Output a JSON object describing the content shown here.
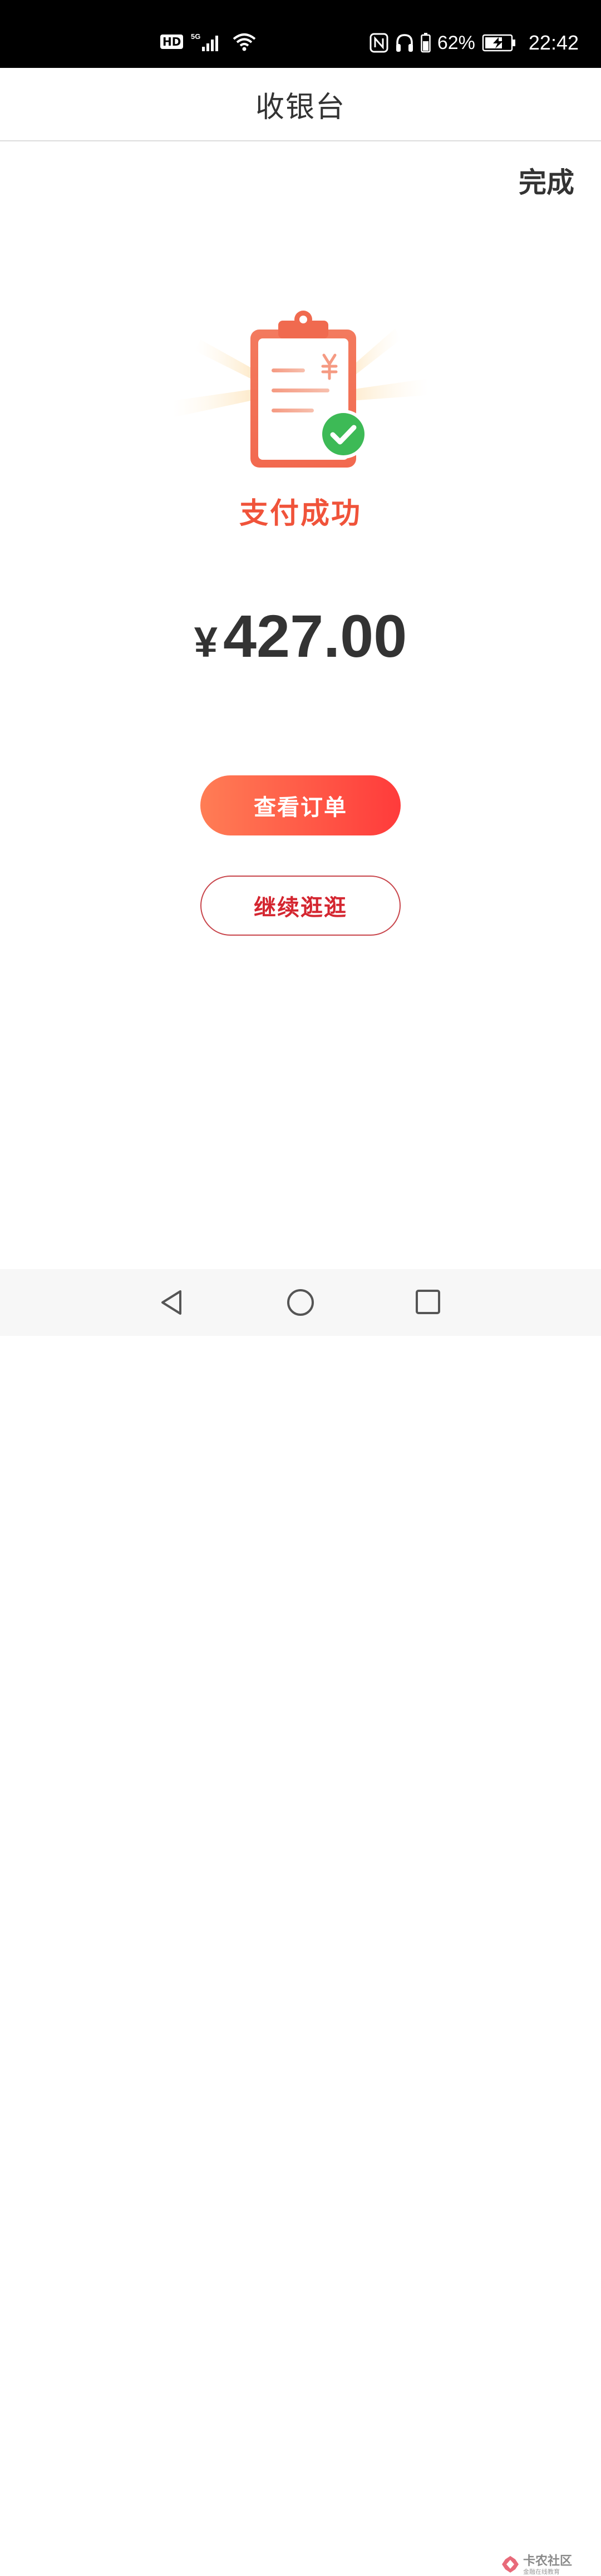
{
  "status_bar": {
    "hd": "HD",
    "network": "5G",
    "battery_percent": "62%",
    "time": "22:42",
    "icons": [
      "hd-icon",
      "signal-5g-icon",
      "wifi-icon",
      "nfc-icon",
      "headphones-icon",
      "battery-icon",
      "charging-icon"
    ]
  },
  "header": {
    "title": "收银台"
  },
  "actions": {
    "done_label": "完成"
  },
  "result": {
    "status_text": "支付成功",
    "currency_symbol": "¥",
    "amount": "427.00",
    "illustration": "clipboard-success-icon"
  },
  "buttons": {
    "view_order_label": "查看订单",
    "continue_shopping_label": "继续逛逛"
  },
  "nav": {
    "icons": [
      "back-icon",
      "home-icon",
      "recent-apps-icon"
    ]
  },
  "watermark": {
    "title": "卡农社区",
    "subtitle": "金融在线教育"
  },
  "colors": {
    "accent_red": "#f0533a",
    "button_gradient_start": "#ff7d55",
    "button_gradient_end": "#ff3b3b",
    "check_green": "#3dba56"
  }
}
